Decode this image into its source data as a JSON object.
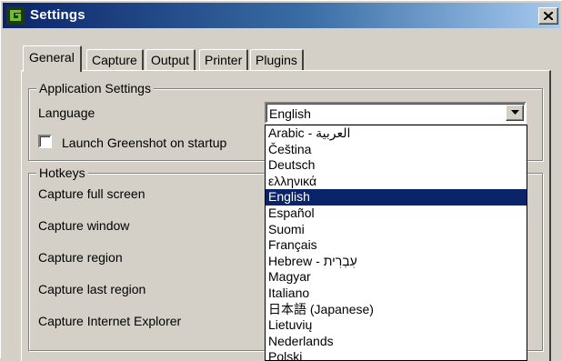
{
  "window": {
    "title": "Settings",
    "close_glyph": "close-icon",
    "app_icon": "greenshot-icon"
  },
  "tabs": [
    {
      "label": "General",
      "active": true
    },
    {
      "label": "Capture",
      "active": false
    },
    {
      "label": "Output",
      "active": false
    },
    {
      "label": "Printer",
      "active": false
    },
    {
      "label": "Plugins",
      "active": false
    }
  ],
  "app_settings": {
    "group_title": "Application Settings",
    "language_label": "Language",
    "language_value": "English",
    "launch_label": "Launch Greenshot on startup",
    "launch_checked": false
  },
  "hotkeys": {
    "group_title": "Hotkeys",
    "items": [
      "Capture full screen",
      "Capture window",
      "Capture region",
      "Capture last region",
      "Capture Internet Explorer"
    ]
  },
  "language_options": [
    "Arabic - العربية",
    "Čeština",
    "Deutsch",
    "ελληνικά",
    "English",
    "Español",
    "Suomi",
    "Français",
    "Hebrew - עִבְרִית",
    "Magyar",
    "Italiano",
    "日本語 (Japanese)",
    "Lietuvių",
    "Nederlands",
    "Polski"
  ],
  "selected_language_index": 4,
  "colors": {
    "face": "#d4d0c8",
    "title_active_start": "#0a246a",
    "title_active_end": "#a6caf0",
    "selection": "#0a246a"
  }
}
